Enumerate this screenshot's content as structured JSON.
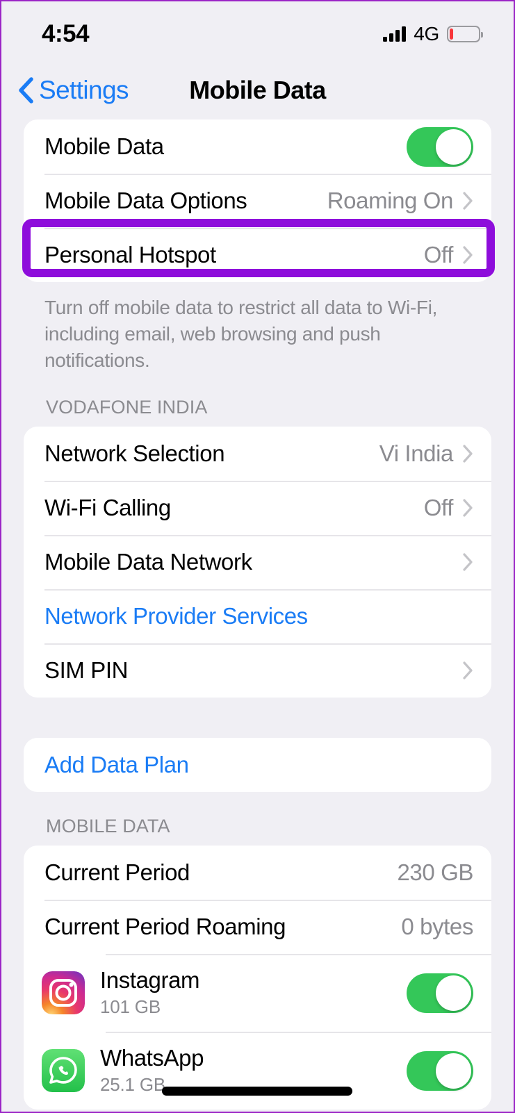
{
  "status_bar": {
    "time": "4:54",
    "network_type": "4G",
    "signal_icon": "signal-bars-icon",
    "battery_icon": "battery-low-icon",
    "battery_level_percent": 12,
    "battery_color": "#f8363a"
  },
  "nav": {
    "back_label": "Settings",
    "title": "Mobile Data",
    "back_icon": "chevron-left-icon",
    "tint_color": "#1a7cf5"
  },
  "sections": {
    "data_toggle": {
      "rows": [
        {
          "label": "Mobile Data",
          "control": "toggle",
          "toggle_on": true
        },
        {
          "label": "Mobile Data Options",
          "value": "Roaming On",
          "chevron": true,
          "highlighted": true
        },
        {
          "label": "Personal Hotspot",
          "value": "Off",
          "chevron": true
        }
      ],
      "footer": "Turn off mobile data to restrict all data to Wi-Fi, including email, web browsing and push notifications."
    },
    "carrier": {
      "header": "VODAFONE INDIA",
      "rows": [
        {
          "label": "Network Selection",
          "value": "Vi India",
          "chevron": true
        },
        {
          "label": "Wi-Fi Calling",
          "value": "Off",
          "chevron": true
        },
        {
          "label": "Mobile Data Network",
          "value": "",
          "chevron": true
        },
        {
          "label": "Network Provider Services",
          "value": "",
          "chevron": false,
          "link": true
        },
        {
          "label": "SIM PIN",
          "value": "",
          "chevron": true
        }
      ]
    },
    "data_plan": {
      "rows": [
        {
          "label": "Add Data Plan",
          "link": true
        }
      ]
    },
    "mobile_data_usage": {
      "header": "MOBILE DATA",
      "rows": [
        {
          "label": "Current Period",
          "value": "230 GB"
        },
        {
          "label": "Current Period Roaming",
          "value": "0 bytes"
        }
      ],
      "apps": [
        {
          "name": "Instagram",
          "size": "101 GB",
          "icon": "instagram-icon",
          "toggle_on": true
        },
        {
          "name": "WhatsApp",
          "size": "25.1 GB",
          "icon": "whatsapp-icon",
          "toggle_on": true
        }
      ]
    }
  },
  "annotation": {
    "highlight_color": "#8e0ddb",
    "target": "Mobile Data Options"
  },
  "colors": {
    "background": "#f0eff4",
    "card": "#ffffff",
    "toggle_on": "#34c759",
    "secondary_text": "#8b8b90",
    "page_border": "#9b25c6"
  }
}
